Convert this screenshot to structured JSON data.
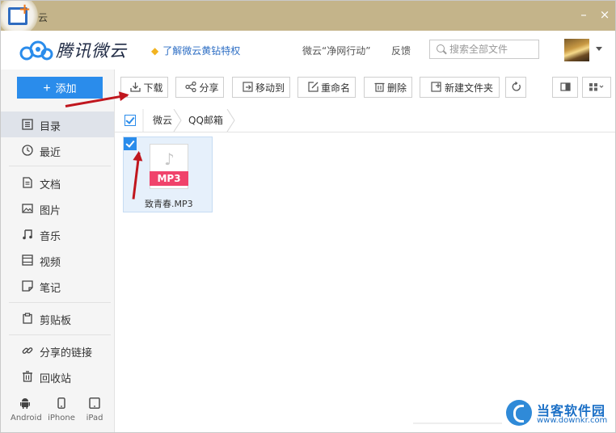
{
  "window": {
    "title": "云",
    "minimize": "–",
    "close": "×"
  },
  "header": {
    "brand": "腾讯微云",
    "promo": "了解微云黄钻特权",
    "links": [
      "微云“净网行动”",
      "反馈"
    ],
    "search_placeholder": "搜索全部文件"
  },
  "sidebar": {
    "add_label": "添加",
    "nav": [
      {
        "label": "目录",
        "icon": "list-icon",
        "active": true
      },
      {
        "label": "最近",
        "icon": "clock-icon"
      },
      {
        "label": "文档",
        "icon": "document-icon"
      },
      {
        "label": "图片",
        "icon": "image-icon"
      },
      {
        "label": "音乐",
        "icon": "music-icon"
      },
      {
        "label": "视频",
        "icon": "film-icon"
      },
      {
        "label": "笔记",
        "icon": "note-icon"
      },
      {
        "label": "剪贴板",
        "icon": "clipboard-icon"
      },
      {
        "label": "分享的链接",
        "icon": "link-icon"
      },
      {
        "label": "回收站",
        "icon": "trash-icon"
      }
    ],
    "devices": [
      "Android",
      "iPhone",
      "iPad"
    ]
  },
  "toolbar": {
    "download": "下载",
    "share": "分享",
    "move": "移动到",
    "rename": "重命名",
    "delete": "删除",
    "new_folder": "新建文件夹"
  },
  "breadcrumb": [
    "微云",
    "QQ邮箱"
  ],
  "files": [
    {
      "name": "致青春.MP3",
      "type_badge": "MP3",
      "selected": true
    }
  ],
  "watermark": {
    "name": "当客软件园",
    "url": "www.downkr.com"
  },
  "colors": {
    "titlebar": "#c4b48a",
    "accent": "#2a8ceb",
    "mp3_badge": "#f0436b",
    "annotation_arrow": "#c0161e"
  }
}
